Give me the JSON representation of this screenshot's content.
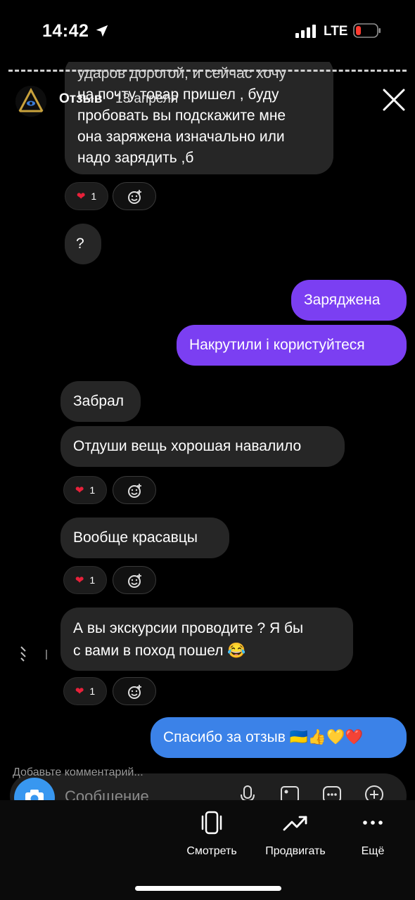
{
  "status_bar": {
    "time": "14:42",
    "network": "LTE"
  },
  "story": {
    "username": "Отзыв",
    "date": "13 апреля"
  },
  "messages": [
    {
      "text": "ударов дорогой, и сейчас хочу"
    },
    {
      "text": "на почту товар пришел , буду"
    },
    {
      "text": "пробовать вы подскажите мне"
    },
    {
      "text": "она заряжена изначально или"
    },
    {
      "text": "надо зарядить ,б"
    },
    {
      "text": "?"
    },
    {
      "text": "Заряджена"
    },
    {
      "text": "Накрутили і користуйтеся"
    },
    {
      "text": "Забрал"
    },
    {
      "text": "Отдуши вещь хорошая навалило"
    },
    {
      "text": "Вообще красавцы"
    },
    {
      "text": "А вы экскурсии проводите ? Я бы"
    },
    {
      "text": "с вами в поход пошел 😂"
    },
    {
      "text": "Спасибо за отзыв 🇺🇦👍💛❤️"
    }
  ],
  "reactions": {
    "heart": "❤️",
    "count": "1"
  },
  "comment": {
    "hint": "Добавьте комментарий...",
    "placeholder": "Сообщение"
  },
  "bottom_bar": {
    "watch": "Смотреть",
    "promote": "Продвигать",
    "more": "Ещё"
  },
  "colors": {
    "outgoing": "#7b3ff2",
    "incoming": "#262626",
    "reply": "#3b82e8",
    "camera": "#3897f0"
  }
}
